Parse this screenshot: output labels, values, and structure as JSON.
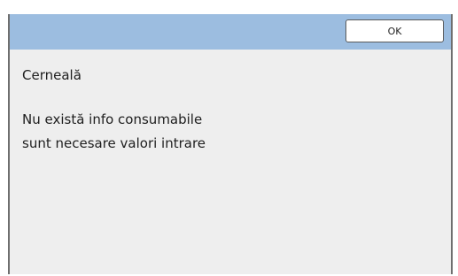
{
  "dialog": {
    "ok_label": "OK",
    "heading": "Cerneală",
    "message_lines": [
      "Nu există info consumabile",
      "sunt necesare valori intrare"
    ]
  },
  "colors": {
    "titlebar": "#9cbde0",
    "panel": "#eeeeee",
    "border": "#6f6f6f",
    "button_bg": "#ffffff"
  }
}
